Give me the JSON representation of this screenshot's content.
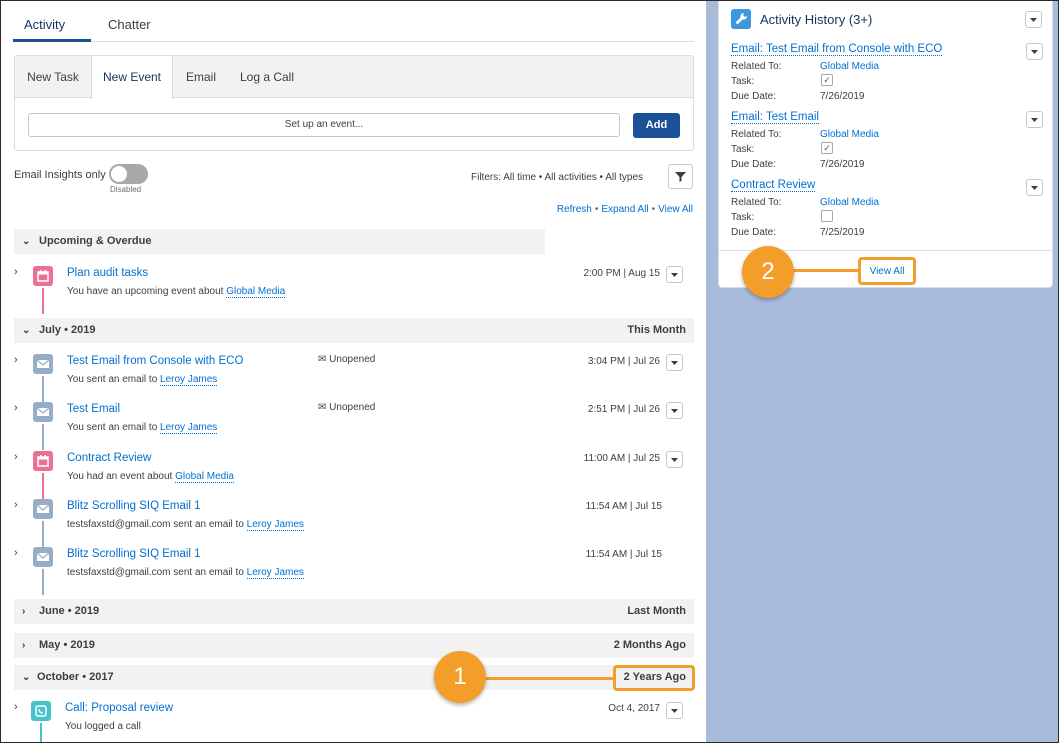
{
  "tabs": {
    "activity": "Activity",
    "chatter": "Chatter"
  },
  "composer": {
    "tabs": [
      "New Task",
      "New Event",
      "Email",
      "Log a Call"
    ],
    "event_placeholder": "Set up an event...",
    "add_label": "Add"
  },
  "insights": {
    "label": "Email Insights only",
    "state": "Disabled"
  },
  "filters": {
    "text": "Filters: All time • All activities • All types"
  },
  "actions": {
    "refresh": "Refresh",
    "expand_all": "Expand All",
    "view_all": "View All"
  },
  "sections": {
    "upcoming": {
      "title": "Upcoming & Overdue"
    },
    "july": {
      "title": "July • 2019",
      "right": "This Month"
    },
    "june": {
      "title": "June • 2019",
      "right": "Last Month"
    },
    "may": {
      "title": "May • 2019",
      "right": "2 Months Ago"
    },
    "october": {
      "title": "October • 2017",
      "right": "2 Years Ago"
    }
  },
  "timeline": [
    {
      "title": "Plan audit tasks",
      "sub_prefix": "You have an upcoming event about ",
      "sub_link": "Global Media",
      "sub_suffix": "",
      "status": "",
      "when": "2:00 PM | Aug 15"
    },
    {
      "title": "Test Email from Console with ECO",
      "sub_prefix": "You sent an email to ",
      "sub_link": "Leroy James",
      "sub_suffix": "",
      "status": "Unopened",
      "when": "3:04 PM | Jul 26"
    },
    {
      "title": "Test Email",
      "sub_prefix": "You sent an email to ",
      "sub_link": "Leroy James",
      "sub_suffix": "",
      "status": "Unopened",
      "when": "2:51 PM | Jul 26"
    },
    {
      "title": "Contract Review",
      "sub_prefix": "You had an event about ",
      "sub_link": "Global Media",
      "sub_suffix": "",
      "status": "",
      "when": "11:00 AM | Jul 25"
    },
    {
      "title": "Blitz Scrolling SIQ Email 1",
      "sub_prefix": "testsfaxstd@gmail.com sent an email to ",
      "sub_link": "Leroy James",
      "sub_suffix": "",
      "status": "",
      "when": "11:54 AM | Jul 15"
    },
    {
      "title": "Blitz Scrolling SIQ Email 1",
      "sub_prefix": "testsfaxstd@gmail.com sent an email to ",
      "sub_link": "Leroy James",
      "sub_suffix": "",
      "status": "",
      "when": "11:54 AM | Jul 15"
    },
    {
      "title": "Call: Proposal review",
      "sub_prefix": "You logged a call",
      "sub_link": "",
      "sub_suffix": "",
      "status": "",
      "when": "Oct 4, 2017"
    }
  ],
  "history": {
    "title": "Activity History (3+)",
    "labels": {
      "related": "Related To:",
      "task": "Task:",
      "due": "Due Date:"
    },
    "items": [
      {
        "title": "Email: Test Email from Console with ECO",
        "related": "Global Media",
        "task_checked": true,
        "due": "7/26/2019"
      },
      {
        "title": "Email: Test Email",
        "related": "Global Media",
        "task_checked": true,
        "due": "7/26/2019"
      },
      {
        "title": "Contract Review",
        "related": "Global Media",
        "task_checked": false,
        "due": "7/25/2019"
      }
    ],
    "view_all": "View All"
  },
  "callouts": {
    "one": "1",
    "two": "2"
  },
  "colors": {
    "event": "#eb7092",
    "email": "#95aec5",
    "call": "#48c3cc",
    "brand": "#1b5297",
    "highlight": "#f39d2b"
  }
}
